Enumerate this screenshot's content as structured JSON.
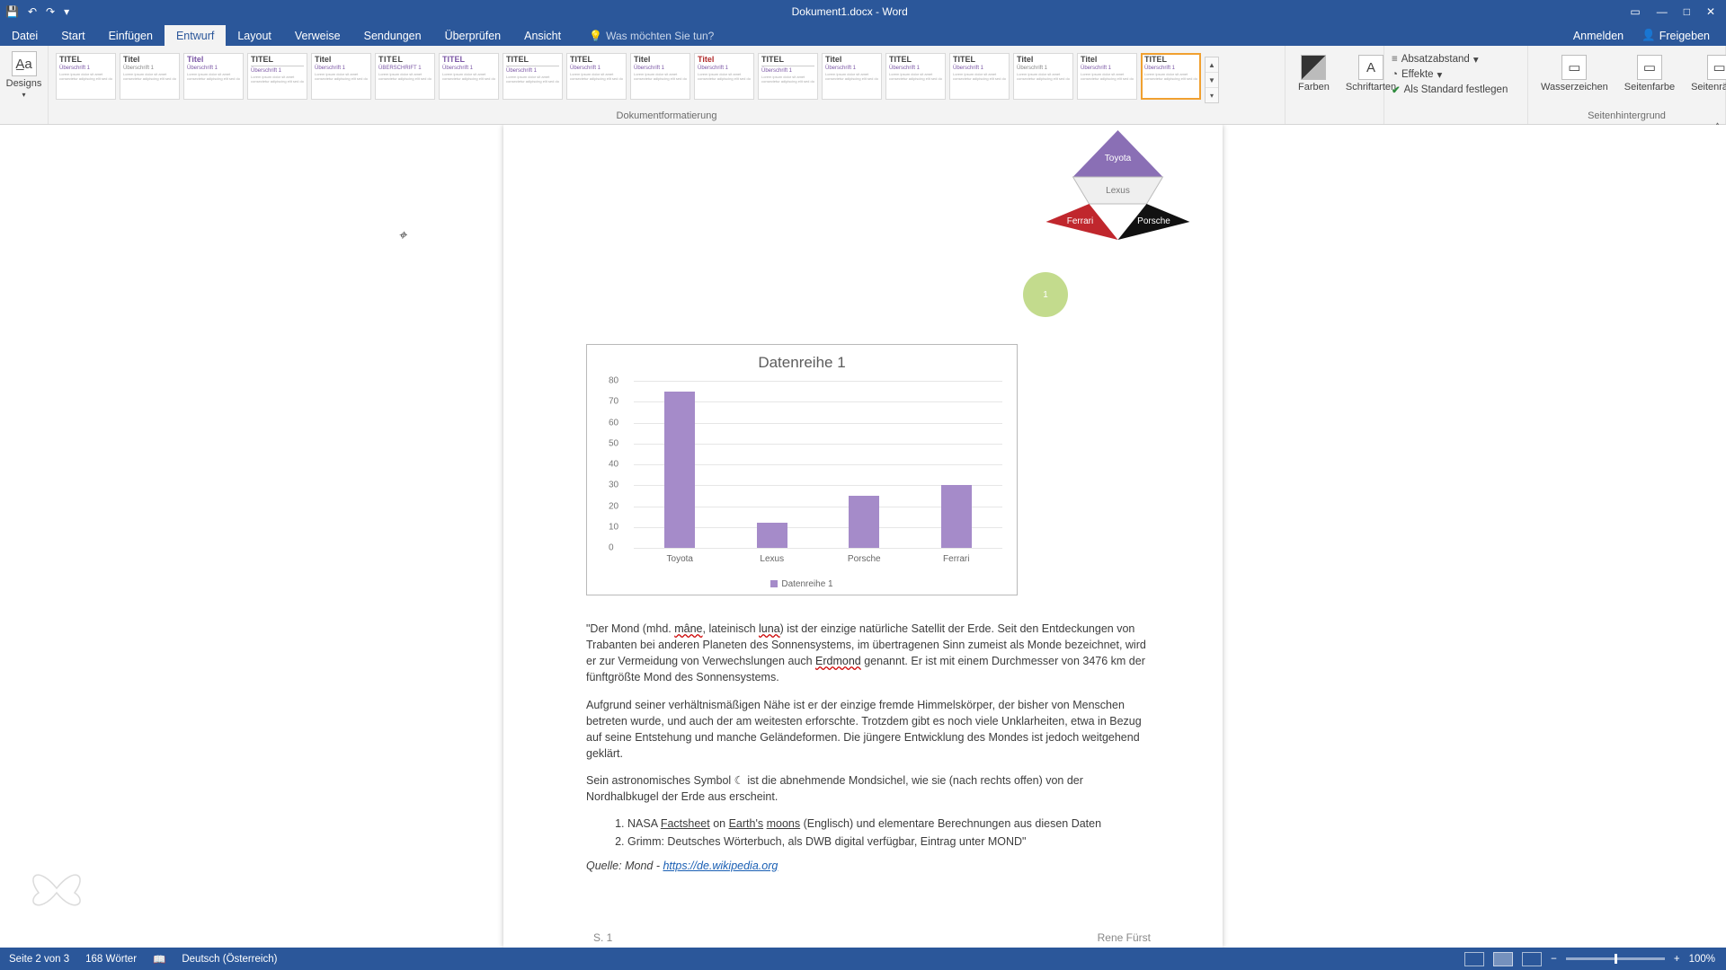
{
  "title_bar": {
    "doc_title": "Dokument1.docx - Word"
  },
  "qat": {
    "save": "💾",
    "undo": "↶",
    "redo": "↷",
    "more": "▾"
  },
  "win": {
    "opts": "▭",
    "min": "—",
    "max": "□",
    "close": "✕"
  },
  "tabs": {
    "items": [
      "Datei",
      "Start",
      "Einfügen",
      "Entwurf",
      "Layout",
      "Verweise",
      "Sendungen",
      "Überprüfen",
      "Ansicht"
    ],
    "active_index": 3,
    "tell_me_placeholder": "Was möchten Sie tun?",
    "sign_in": "Anmelden",
    "share": "Freigeben"
  },
  "ribbon": {
    "designs": "Designs",
    "doc_format_group": "Dokumentformatierung",
    "bg_group": "Seitenhintergrund",
    "colors": "Farben",
    "fonts": "Schriftarten",
    "para_spacing": "Absatzabstand",
    "effects": "Effekte",
    "set_default": "Als Standard festlegen",
    "watermark": "Wasserzeichen",
    "page_color": "Seitenfarbe",
    "page_borders": "Seitenränder",
    "styles": [
      {
        "title": "TITEL",
        "sub": "Überschrift 1",
        "variant": ""
      },
      {
        "title": "Titel",
        "sub": "Überschrift 1",
        "variant": "grey"
      },
      {
        "title": "Titel",
        "sub": "Überschrift 1",
        "variant": "purple"
      },
      {
        "title": "TITEL",
        "sub": "Überschrift 1",
        "variant": "rule"
      },
      {
        "title": "Titel",
        "sub": "Überschrift 1",
        "variant": ""
      },
      {
        "title": "TITEL",
        "sub": "ÜBERSCHRIFT 1",
        "variant": "caps"
      },
      {
        "title": "TITEL",
        "sub": "Überschrift 1",
        "variant": "purple"
      },
      {
        "title": "TITEL",
        "sub": "Überschrift 1",
        "variant": "rule"
      },
      {
        "title": "TITEL",
        "sub": "Überschrift 1",
        "variant": ""
      },
      {
        "title": "Titel",
        "sub": "Überschrift 1",
        "variant": ""
      },
      {
        "title": "Titel",
        "sub": "Überschrift 1",
        "variant": "red"
      },
      {
        "title": "TITEL",
        "sub": "Überschrift 1",
        "variant": "rule"
      },
      {
        "title": "Titel",
        "sub": "Überschrift 1",
        "variant": ""
      },
      {
        "title": "TITEL",
        "sub": "Überschrift 1",
        "variant": ""
      },
      {
        "title": "TITEL",
        "sub": "Überschrift 1",
        "variant": ""
      },
      {
        "title": "Titel",
        "sub": "Überschrift 1",
        "variant": "grey"
      },
      {
        "title": "Titel",
        "sub": "Überschrift 1",
        "variant": ""
      },
      {
        "title": "TITEL",
        "sub": "Überschrift 1",
        "variant": "selected"
      }
    ]
  },
  "pyramid": {
    "labels": [
      "Toyota",
      "Lexus",
      "Ferrari",
      "Porsche"
    ]
  },
  "chart_data": {
    "type": "bar",
    "title": "Datenreihe 1",
    "categories": [
      "Toyota",
      "Lexus",
      "Porsche",
      "Ferrari"
    ],
    "values": [
      75,
      12,
      25,
      30
    ],
    "ylim": [
      0,
      80
    ],
    "ystep": 10,
    "series_name": "Datenreihe 1",
    "color": "#a58bc9"
  },
  "para": {
    "p1a": "\"Der Mond (mhd. ",
    "p1_err1": "mâne",
    "p1b": ", lateinisch ",
    "p1_err2": "luna",
    "p1c": ") ist der einzige natürliche Satellit der Erde. Seit den Entdeckungen von Trabanten bei anderen Planeten des Sonnensystems, im übertragenen Sinn zumeist als Monde bezeichnet, wird er zur Vermeidung von Verwechslungen auch ",
    "p1_err3": "Erdmond",
    "p1d": " genannt. Er ist mit einem Durchmesser von 3476 km der fünftgrößte Mond des Sonnensystems.",
    "p2": "Aufgrund seiner verhältnismäßigen Nähe ist er der einzige fremde Himmelskörper, der bisher von Menschen betreten wurde, und auch der am weitesten erforschte. Trotzdem gibt es noch viele Unklarheiten, etwa in Bezug auf seine Entstehung und manche Geländeformen. Die jüngere Entwicklung des Mondes ist jedoch weitgehend geklärt.",
    "p3": "Sein astronomisches Symbol ☾ ist die abnehmende Mondsichel, wie sie (nach rechts offen) von der Nordhalbkugel der Erde aus erscheint.",
    "li1a": "NASA ",
    "li1_u1": "Factsheet",
    "li1b": " on ",
    "li1_u2": "Earth's",
    "li1c": " ",
    "li1_u3": "moons",
    "li1d": " (Englisch) und elementare Berechnungen aus diesen Daten",
    "li2": "Grimm: Deutsches Wörterbuch, als DWB digital verfügbar, Eintrag unter MOND\"",
    "src_label": "Quelle: Mond - ",
    "src_url": "https://de.wikipedia.org",
    "page_no": "S. 1",
    "owner": "Rene Fürst"
  },
  "status": {
    "page": "Seite 2 von 3",
    "words": "168 Wörter",
    "lang": "Deutsch (Österreich)",
    "zoom": "100%"
  }
}
